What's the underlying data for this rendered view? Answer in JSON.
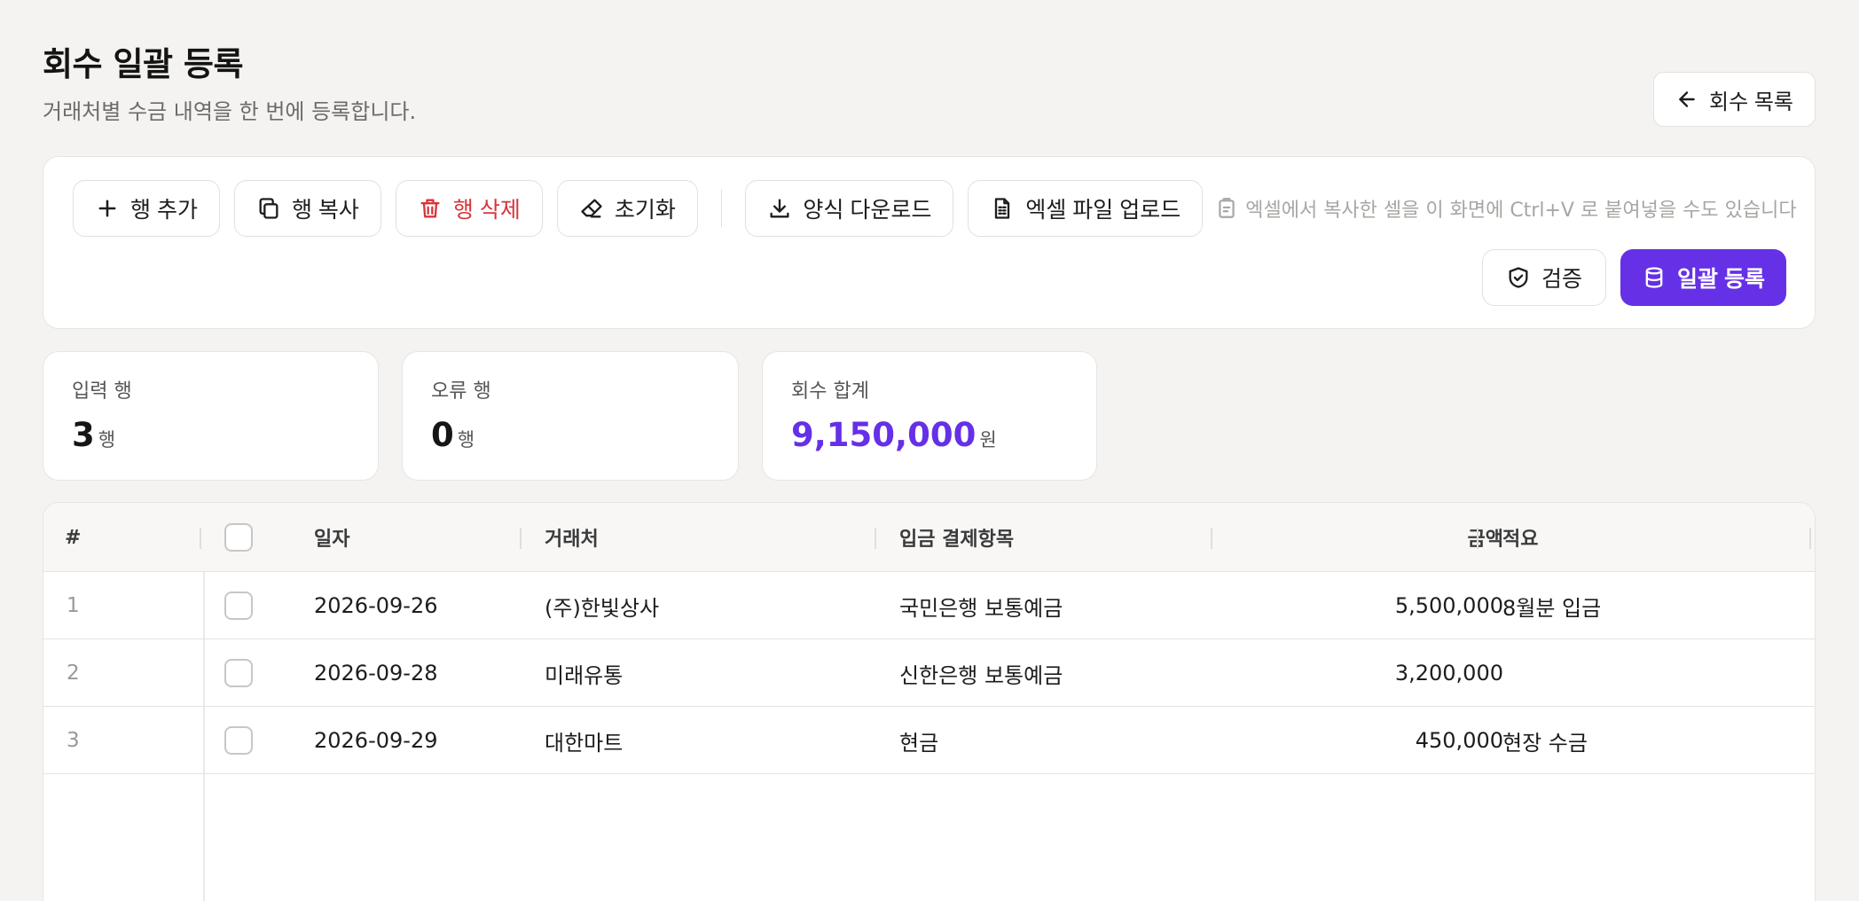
{
  "header": {
    "title": "회수 일괄 등록",
    "subtitle": "거래처별 수금 내역을 한 번에 등록합니다.",
    "back_label": "회수 목록"
  },
  "toolbar": {
    "add_row": "행 추가",
    "copy_row": "행 복사",
    "delete_row": "행 삭제",
    "reset": "초기화",
    "download_template": "양식 다운로드",
    "upload_excel": "엑셀 파일 업로드",
    "paste_hint": "엑셀에서 복사한 셀을 이 화면에 Ctrl+V 로 붙여넣을 수도 있습니다",
    "verify": "검증",
    "submit": "일괄 등록"
  },
  "stats": {
    "input_rows": {
      "label": "입력 행",
      "value": "3",
      "unit": "행"
    },
    "error_rows": {
      "label": "오류 행",
      "value": "0",
      "unit": "행"
    },
    "total": {
      "label": "회수 합계",
      "value": "9,150,000",
      "unit": "원"
    }
  },
  "table": {
    "columns": {
      "index": "#",
      "date": "일자",
      "client": "거래처",
      "payment_item": "입금 결제항목",
      "amount": "금액",
      "memo": "적요"
    },
    "rows": [
      {
        "index": "1",
        "date": "2026-09-26",
        "client": "(주)한빛상사",
        "payment_item": "국민은행 보통예금",
        "amount": "5,500,000",
        "memo": "8월분 입금"
      },
      {
        "index": "2",
        "date": "2026-09-28",
        "client": "미래유통",
        "payment_item": "신한은행 보통예금",
        "amount": "3,200,000",
        "memo": ""
      },
      {
        "index": "3",
        "date": "2026-09-29",
        "client": "대한마트",
        "payment_item": "현금",
        "amount": "450,000",
        "memo": "현장 수금"
      }
    ]
  },
  "colors": {
    "accent": "#6530e6",
    "danger": "#d6353a",
    "background": "#f4f3f1"
  }
}
